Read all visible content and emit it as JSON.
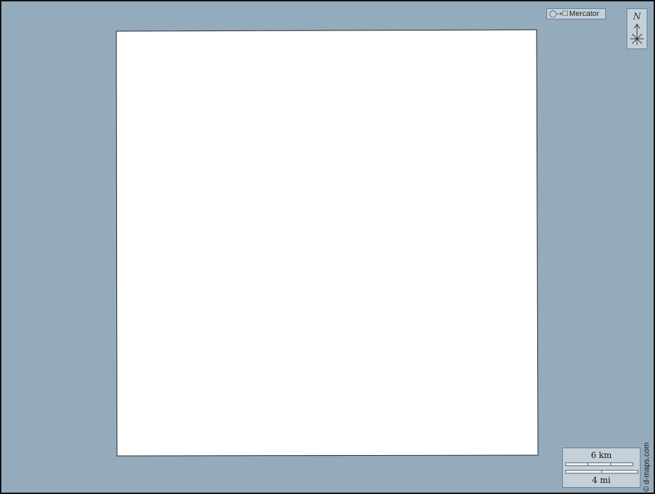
{
  "map": {
    "water_color": "#94abbc",
    "land_color": "#ffffff",
    "border_color": "#222222"
  },
  "projection": {
    "glyphs": "◯→☐",
    "label": "Mercator"
  },
  "compass": {
    "north_label": "N",
    "icon": "compass-rose-icon"
  },
  "scale_bar": {
    "km_label": "6 km",
    "mi_label": "4 mi"
  },
  "credit": {
    "text": "© d-maps.com"
  }
}
